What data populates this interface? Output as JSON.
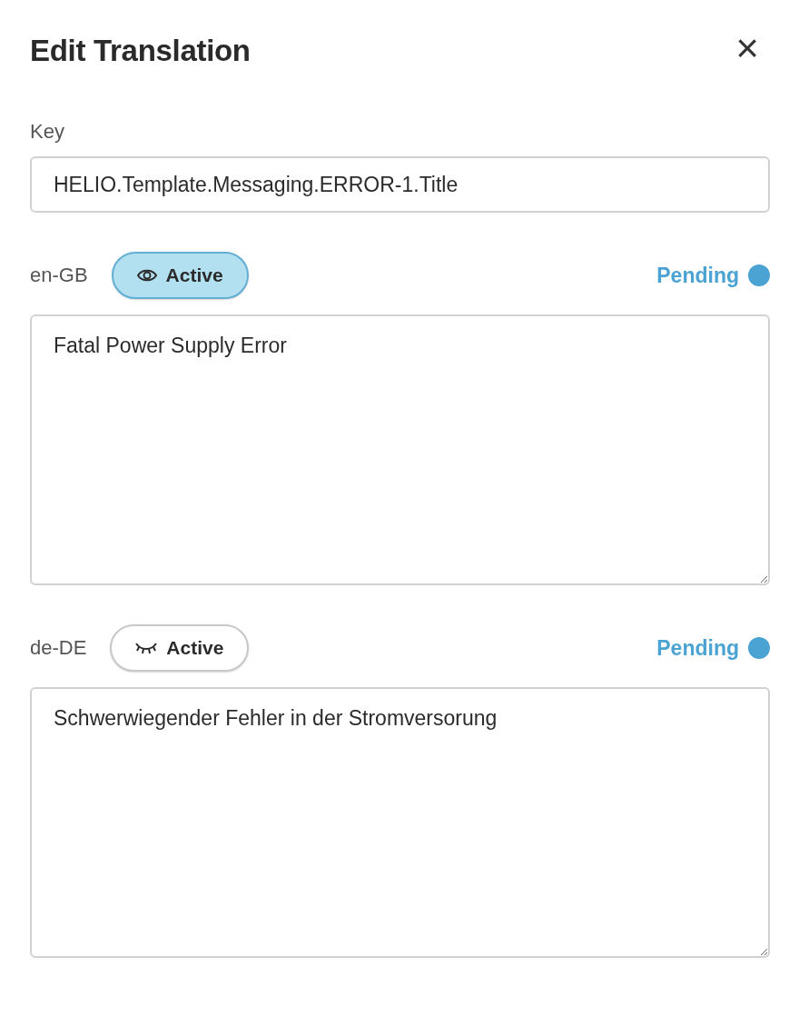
{
  "dialog": {
    "title": "Edit Translation",
    "close_icon": "×"
  },
  "key": {
    "label": "Key",
    "value": "HELIO.Template.Messaging.ERROR-1.Title"
  },
  "translations": [
    {
      "locale": "en-GB",
      "toggle": {
        "label": "Active",
        "active": true
      },
      "status": {
        "label": "Pending",
        "color": "#4ba3d3"
      },
      "value": "Fatal Power Supply Error"
    },
    {
      "locale": "de-DE",
      "toggle": {
        "label": "Active",
        "active": false
      },
      "status": {
        "label": "Pending",
        "color": "#4ba3d3"
      },
      "value": "Schwerwiegender Fehler in der Stromversorung"
    }
  ]
}
